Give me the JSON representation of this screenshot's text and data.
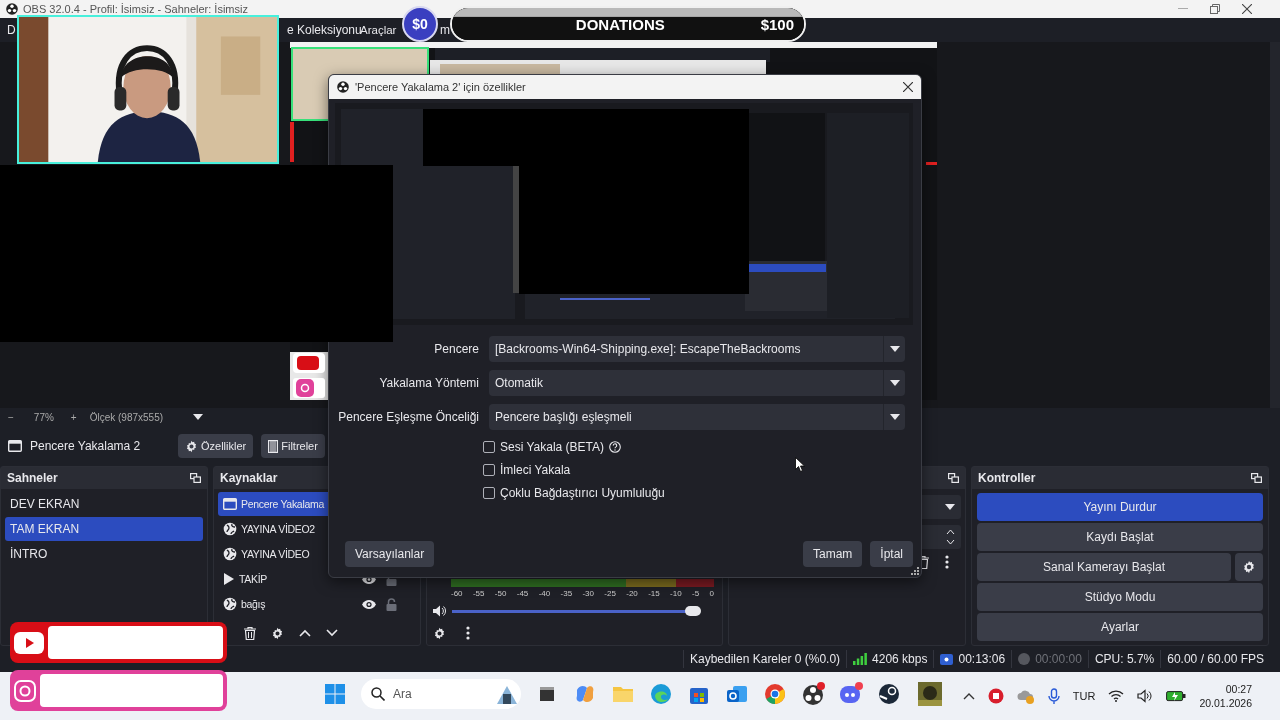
{
  "window": {
    "title": "OBS 32.0.4 - Profil: İsimsiz - Sahneler: İsimsiz"
  },
  "menu": [
    "D",
    "e Koleksiyonu",
    "Araçlar",
    "m"
  ],
  "donation_bar": {
    "raised": "$0",
    "title": "DONATIONS",
    "goal": "$100"
  },
  "preview": {
    "zoom_out": "−",
    "zoom": "77%",
    "zoom_in": "+",
    "scale": "Ölçek (987x555)"
  },
  "source_toolbar": {
    "source": "Pencere Yakalama 2",
    "buttons": [
      "Özellikler",
      "Filtreler"
    ]
  },
  "scenes": {
    "title": "Sahneler",
    "items": [
      {
        "name": "DEV EKRAN",
        "selected": false
      },
      {
        "name": "TAM EKRAN",
        "selected": true
      },
      {
        "name": "İNTRO",
        "selected": false
      }
    ]
  },
  "sources": {
    "title": "Kaynaklar",
    "items": [
      {
        "name": "Pencere Yakalama",
        "kind": "window",
        "selected": true
      },
      {
        "name": "YAYINA VİDEO2",
        "kind": "browser",
        "selected": false
      },
      {
        "name": "YAYINA VİDEO",
        "kind": "browser",
        "selected": false
      },
      {
        "name": "TAKİP",
        "kind": "media",
        "selected": false,
        "visible": true,
        "locked": false
      },
      {
        "name": "bağış",
        "kind": "browser",
        "selected": false,
        "visible": true,
        "locked": false
      }
    ]
  },
  "mixer": {
    "ticks": [
      "-60",
      "-55",
      "-50",
      "-45",
      "-40",
      "-35",
      "-30",
      "-25",
      "-20",
      "-15",
      "-10",
      "-5",
      "0"
    ],
    "volume": {
      "level": 0.97
    }
  },
  "controls": {
    "title": "Kontroller",
    "buttons": [
      {
        "label": "Yayını Durdur",
        "active": true,
        "settings": false
      },
      {
        "label": "Kaydı Başlat",
        "active": false,
        "settings": false
      },
      {
        "label": "Sanal Kamerayı Başlat",
        "active": false,
        "settings": true
      },
      {
        "label": "Stüdyo Modu",
        "active": false,
        "settings": false
      },
      {
        "label": "Ayarlar",
        "active": false,
        "settings": false
      }
    ]
  },
  "status_bar": {
    "dropped": "Kaybedilen Kareler 0 (%0.0)",
    "bitrate": "4206 kbps",
    "stream_time": "00:13:06",
    "record_time": "00:00:00",
    "cpu": "CPU: 5.7%",
    "fps": "60.00 / 60.00 FPS"
  },
  "dialog": {
    "title": "'Pencere Yakalama 2' için özellikler",
    "fields": [
      {
        "label": "Pencere",
        "value": "[Backrooms-Win64-Shipping.exe]: EscapeTheBackrooms"
      },
      {
        "label": "Yakalama Yöntemi",
        "value": "Otomatik"
      },
      {
        "label": "Pencere Eşleşme Önceliği",
        "value": "Pencere başlığı eşleşmeli"
      }
    ],
    "checkboxes": [
      {
        "label": "Sesi Yakala (BETA)",
        "checked": false,
        "help": true
      },
      {
        "label": "İmleci Yakala",
        "checked": false,
        "help": false
      },
      {
        "label": "Çoklu Bağdaştırıcı Uyumluluğu",
        "checked": false,
        "help": false
      }
    ],
    "buttons": [
      "Varsayılanlar",
      "Tamam",
      "İptal"
    ]
  },
  "taskbar": {
    "search_placeholder": "Ara",
    "language": "TUR",
    "time": "00:27",
    "date": "20.01.2026"
  }
}
